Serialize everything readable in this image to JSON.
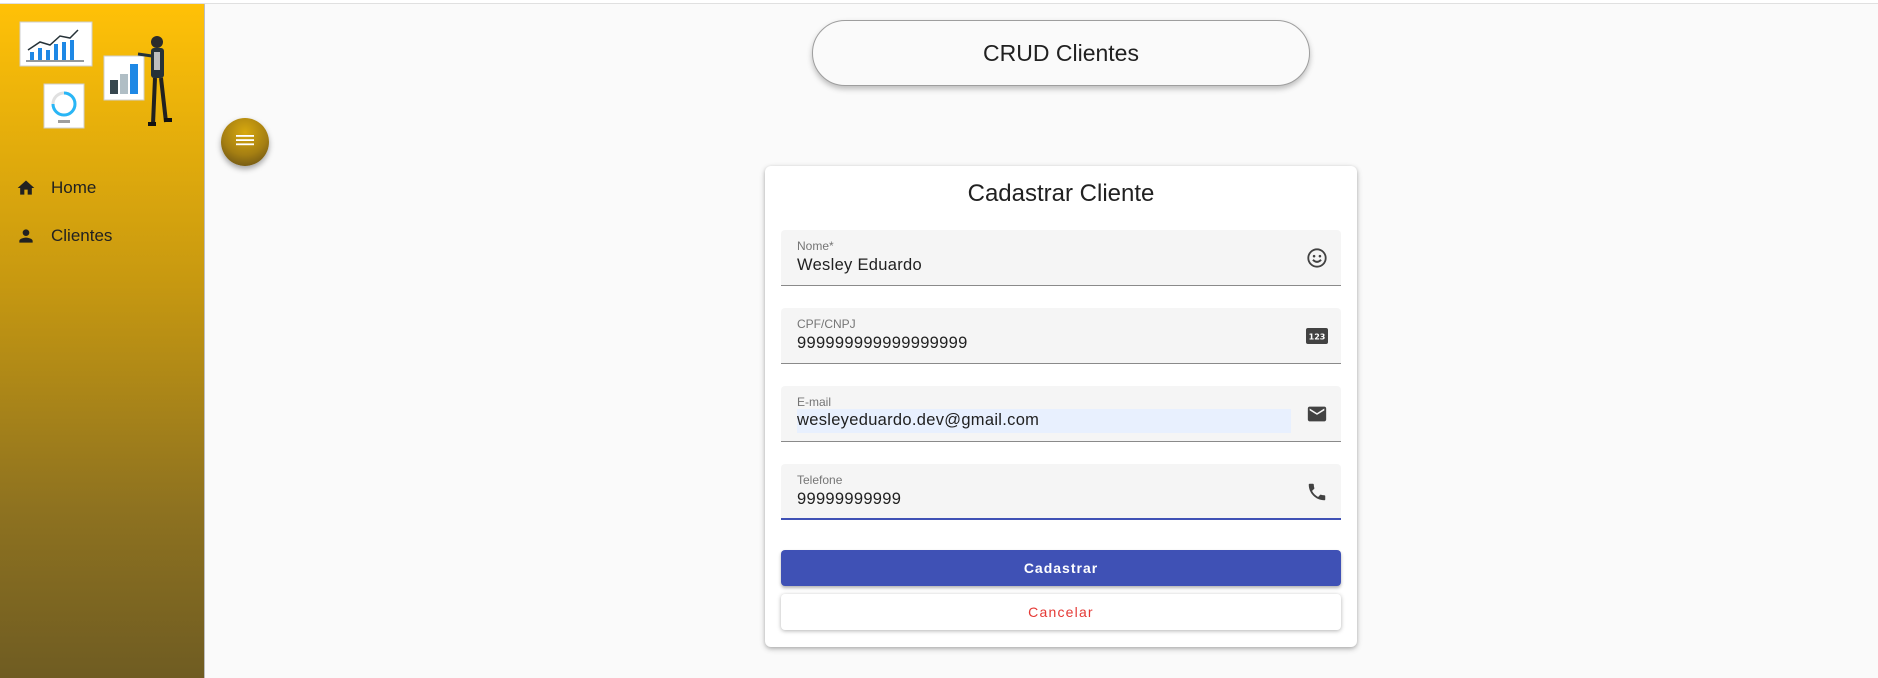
{
  "page": {
    "title": "CRUD Clientes"
  },
  "sidebar": {
    "illustration_icon": "dashboard-charts-illustration",
    "items": [
      {
        "label": "Home",
        "icon": "home-icon"
      },
      {
        "label": "Clientes",
        "icon": "person-icon"
      }
    ]
  },
  "menu_button": {
    "icon": "menu-icon"
  },
  "form": {
    "title": "Cadastrar Cliente",
    "fields": [
      {
        "label": "Nome*",
        "value": "Wesley Eduardo",
        "icon": "face-icon"
      },
      {
        "label": "CPF/CNPJ",
        "value": "999999999999999999",
        "icon": "pin-123-icon"
      },
      {
        "label": "E-mail",
        "value": "wesleyeduardo.dev@gmail.com",
        "icon": "mail-icon"
      },
      {
        "label": "Telefone",
        "value": "99999999999",
        "icon": "phone-icon"
      }
    ],
    "submit_label": "Cadastrar",
    "cancel_label": "Cancelar"
  },
  "colors": {
    "sidebar_top": "#ffc107",
    "sidebar_bottom": "#6f5c22",
    "primary": "#3f51b5",
    "cancel_text": "#e53935"
  }
}
